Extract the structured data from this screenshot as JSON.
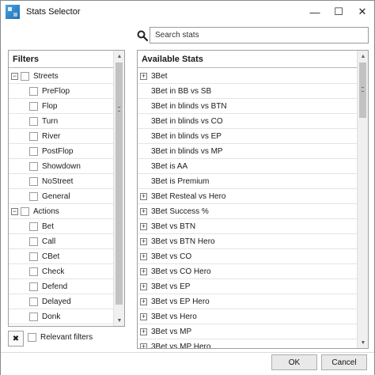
{
  "window": {
    "title": "Stats Selector"
  },
  "search": {
    "placeholder": "Search stats"
  },
  "filters": {
    "header": "Filters",
    "groups": [
      {
        "label": "Streets",
        "expander": "−",
        "children": [
          "PreFlop",
          "Flop",
          "Turn",
          "River",
          "PostFlop",
          "Showdown",
          "NoStreet",
          "General"
        ]
      },
      {
        "label": "Actions",
        "expander": "−",
        "children": [
          "Bet",
          "Call",
          "CBet",
          "Check",
          "Defend",
          "Delayed",
          "Donk"
        ]
      }
    ]
  },
  "stats": {
    "header": "Available Stats",
    "items": [
      {
        "label": "3Bet",
        "expandable": true
      },
      {
        "label": "3Bet in BB vs SB",
        "expandable": false
      },
      {
        "label": "3Bet in blinds vs BTN",
        "expandable": false
      },
      {
        "label": "3Bet in blinds vs CO",
        "expandable": false
      },
      {
        "label": "3Bet in blinds vs EP",
        "expandable": false
      },
      {
        "label": "3Bet in blinds vs MP",
        "expandable": false
      },
      {
        "label": "3Bet is AA",
        "expandable": false
      },
      {
        "label": "3Bet is Premium",
        "expandable": false
      },
      {
        "label": "3Bet Resteal vs Hero",
        "expandable": true
      },
      {
        "label": "3Bet Success %",
        "expandable": true
      },
      {
        "label": "3Bet vs BTN",
        "expandable": true
      },
      {
        "label": "3Bet vs BTN Hero",
        "expandable": true
      },
      {
        "label": "3Bet vs CO",
        "expandable": true
      },
      {
        "label": "3Bet vs CO Hero",
        "expandable": true
      },
      {
        "label": "3Bet vs EP",
        "expandable": true
      },
      {
        "label": "3Bet vs EP Hero",
        "expandable": true
      },
      {
        "label": "3Bet vs Hero",
        "expandable": true
      },
      {
        "label": "3Bet vs MP",
        "expandable": true
      },
      {
        "label": "3Bet vs MP Hero",
        "expandable": true
      }
    ]
  },
  "footer": {
    "clear_icon": "✖",
    "relevant_label": "Relevant filters",
    "ok_label": "OK",
    "cancel_label": "Cancel"
  },
  "icons": {
    "minimize": "—",
    "maximize": "☐",
    "close": "✕",
    "scroll_up": "▲",
    "scroll_down": "▼"
  },
  "colors": {
    "accent": "#1f6fb5",
    "border": "#a0a0a0",
    "button": "#e9e9e9"
  }
}
